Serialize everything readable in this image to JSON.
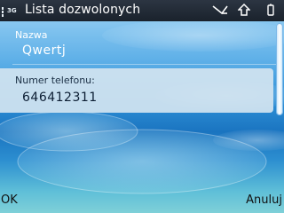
{
  "status_bar": {
    "title": "Lista dozwolonych",
    "network": "3G",
    "icons": [
      "signal-icon",
      "message-icon",
      "upload-arrow-icon",
      "battery-icon"
    ]
  },
  "form": {
    "name_field": {
      "label": "Nazwa",
      "value": "Qwertj"
    },
    "phone_field": {
      "label": "Numer telefonu:",
      "value": "646412311"
    }
  },
  "softkeys": {
    "left": "OK",
    "right": "Anuluj"
  },
  "colors": {
    "statusbar": "#1a222c",
    "background_blue": "#1a74c0",
    "selected_field": "#d2e4f0"
  }
}
